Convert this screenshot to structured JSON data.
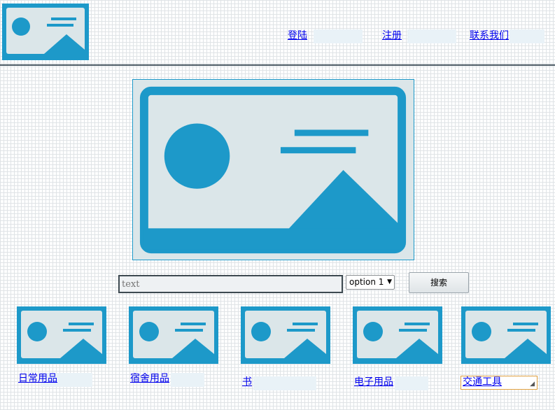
{
  "header": {
    "logo_icon": "image-placeholder-icon",
    "nav": [
      {
        "label": "登陆"
      },
      {
        "label": "注册"
      },
      {
        "label": "联系我们"
      }
    ]
  },
  "banner": {
    "icon": "image-placeholder-icon"
  },
  "search": {
    "placeholder": "text",
    "select_value": "option 1",
    "button_label": "搜索"
  },
  "categories": [
    {
      "label": "日常用品",
      "icon": "image-placeholder-icon"
    },
    {
      "label": "宿舍用品",
      "icon": "image-placeholder-icon"
    },
    {
      "label": "书",
      "icon": "image-placeholder-icon"
    },
    {
      "label": "电子用品",
      "icon": "image-placeholder-icon"
    },
    {
      "label": "交通工具",
      "icon": "image-placeholder-icon"
    }
  ],
  "colors": {
    "placeholder_blue": "#1d99c9",
    "placeholder_bg": "#dbe6e9",
    "divider": "#4b5a64"
  }
}
